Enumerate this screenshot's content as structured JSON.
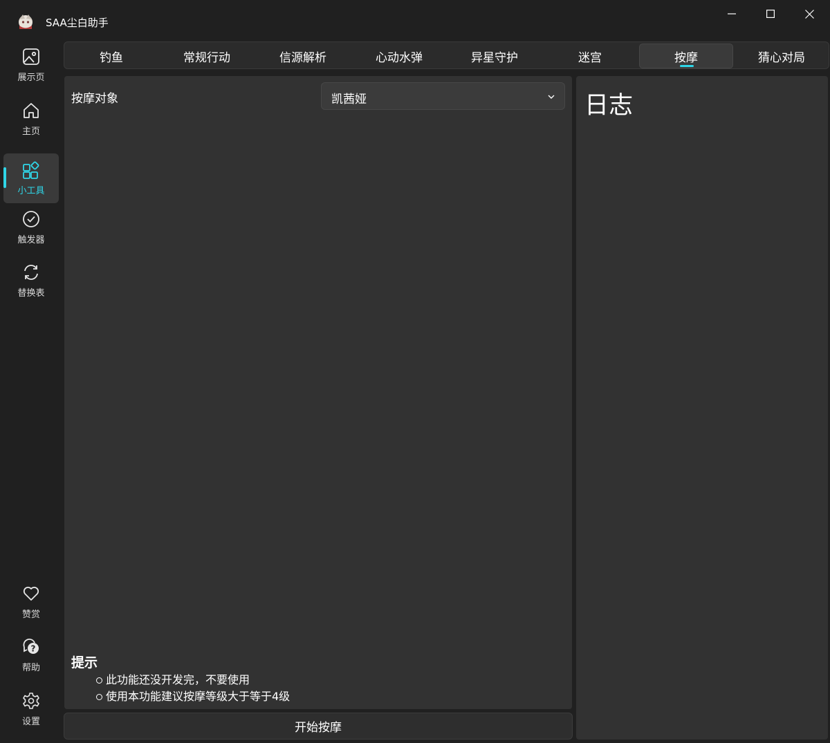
{
  "window": {
    "title": "SAA尘白助手",
    "controls": [
      "minimize-icon",
      "maximize-icon",
      "close-icon"
    ]
  },
  "sidebar": {
    "items": [
      {
        "label": "展示页",
        "icon": "image-icon"
      },
      {
        "label": "主页",
        "icon": "home-icon"
      },
      {
        "label": "小工具",
        "icon": "apps-icon",
        "active": true
      },
      {
        "label": "触发器",
        "icon": "check-circle-icon"
      },
      {
        "label": "替换表",
        "icon": "refresh-icon"
      }
    ],
    "bottom_items": [
      {
        "label": "赞赏",
        "icon": "heart-icon"
      },
      {
        "label": "帮助",
        "icon": "help-chat-icon"
      },
      {
        "label": "设置",
        "icon": "gear-icon"
      }
    ]
  },
  "tabs": [
    {
      "label": "钓鱼"
    },
    {
      "label": "常规行动"
    },
    {
      "label": "信源解析"
    },
    {
      "label": "心动水弹"
    },
    {
      "label": "异星守护"
    },
    {
      "label": "迷宫"
    },
    {
      "label": "按摩",
      "active": true
    },
    {
      "label": "猜心对局"
    }
  ],
  "main": {
    "target_label": "按摩对象",
    "target_value": "凯茜娅",
    "tips_title": "提示",
    "tips": [
      "此功能还没开发完，不要使用",
      "使用本功能建议按摩等级大于等于4级"
    ],
    "start_button": "开始按摩"
  },
  "log": {
    "title": "日志"
  },
  "colors": {
    "accent": "#2fd6e8",
    "background": "#202020",
    "panel": "#323232"
  }
}
